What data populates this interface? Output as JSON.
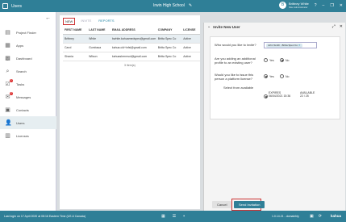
{
  "titlebar": {
    "app_title": "Users",
    "school": "Irwin High School",
    "user_name": "Brittney White",
    "user_role": "Site Administrator",
    "avatar_initial": "B"
  },
  "sidebar": {
    "items": [
      {
        "label": "Project Finder",
        "icon": "folder-icon"
      },
      {
        "label": "Apps",
        "icon": "apps-icon"
      },
      {
        "label": "Dashboard",
        "icon": "dashboard-icon"
      },
      {
        "label": "Search",
        "icon": "search-icon"
      },
      {
        "label": "Tasks",
        "icon": "tasks-icon",
        "badge": "1"
      },
      {
        "label": "Messages",
        "icon": "messages-icon",
        "badge": "2"
      },
      {
        "label": "Contacts",
        "icon": "contacts-icon"
      },
      {
        "label": "Users",
        "icon": "users-icon"
      },
      {
        "label": "Licenses",
        "icon": "licenses-icon"
      }
    ]
  },
  "main": {
    "tabs": [
      {
        "label": "NEW"
      },
      {
        "label": "INVITE"
      },
      {
        "label": "REPORTS"
      }
    ],
    "columns": [
      "FIRST NAME",
      "LAST NAME",
      "EMAIL ADDRESS",
      "COMPANY",
      "LICENSE"
    ],
    "rows": [
      [
        "Brittney",
        "White",
        "bwhite.kahuamedspec@gmail.com",
        "Britta Spec Co",
        "Active"
      ],
      [
        "Carol",
        "Gumbaca",
        "kahua.cid+infsi@gmail.com",
        "Britta Spec Co",
        "Active"
      ],
      [
        "Shania",
        "Wilson",
        "kahuashermsol@gmail.com",
        "Britta Spec Co",
        "Active"
      ]
    ],
    "item_count": "3 Item(s)"
  },
  "panel": {
    "title": "Invite New User",
    "q1": "Who would you like to invite?",
    "chip": "John Smith - Britta Spec Co",
    "q2": "Are you adding an additional profile to an existing user?",
    "q3": "Would you like to issue this person a platform license?",
    "opt_yes": "Yes",
    "opt_no": "No",
    "select_from": "Select from available",
    "expires_label": "EXPIRES",
    "expires_value": "06/04/2021 15:36",
    "available_label": "AVAILABLE",
    "available_value": "22 / 25",
    "cancel": "Cancel",
    "send": "Send Invitation"
  },
  "status": {
    "left": "Last login on 17 April 2020 at 08:16 Eastern Time (US & Canada)",
    "right": "1.0.14.21 - domainhty",
    "brand": "kahua"
  }
}
